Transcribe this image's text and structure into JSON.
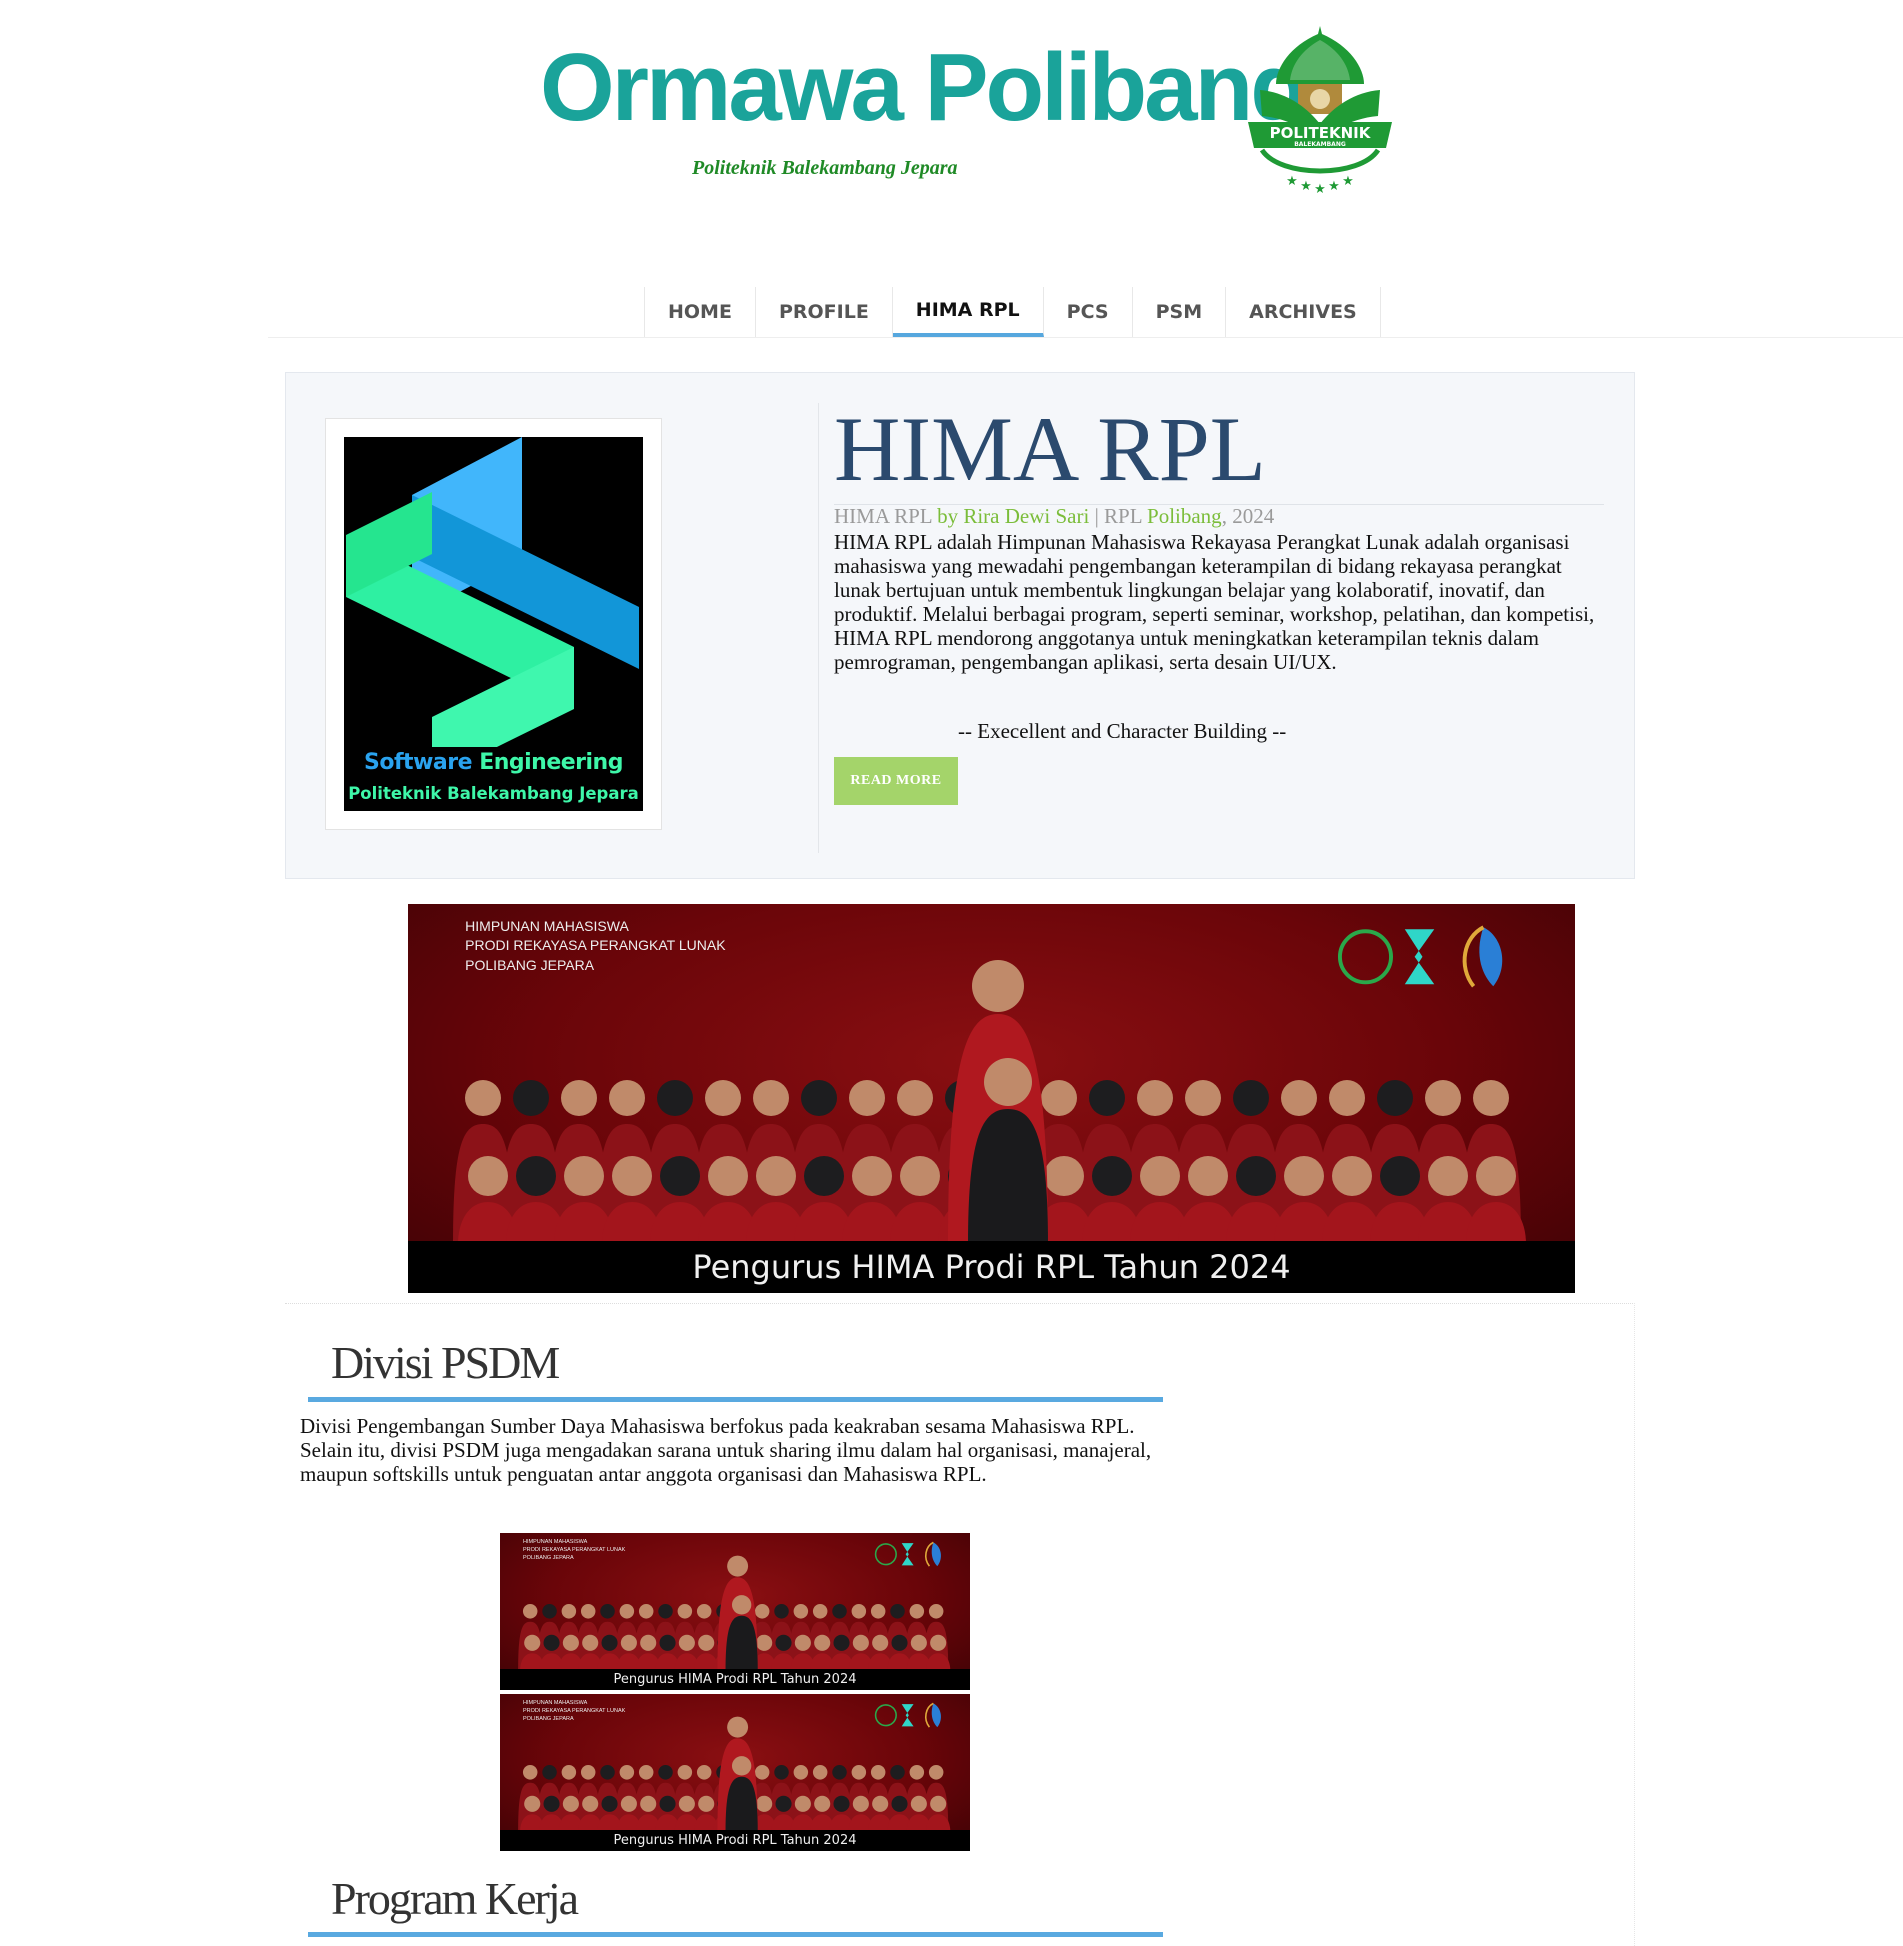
{
  "header": {
    "site_title": "Ormawa Polibang",
    "tagline": "Politeknik Balekambang Jepara",
    "logo_text": "POLITEKNIK",
    "logo_subtext": "BALEKAMBANG"
  },
  "nav": {
    "items": [
      "HOME",
      "PROFILE",
      "HIMA RPL",
      "PCS",
      "PSM",
      "ARCHIVES"
    ],
    "active": "HIMA RPL"
  },
  "feature": {
    "thumb_line1_a": "Software",
    "thumb_line1_b": "Engineering",
    "thumb_line2": "Politeknik Balekambang Jepara",
    "title": "HIMA RPL",
    "meta_category": "HIMA RPL",
    "meta_by": "by",
    "meta_author": "Rira Dewi Sari",
    "meta_sep": "|",
    "meta_tag1": "RPL",
    "meta_tag2": "Polibang",
    "meta_year": ", 2024",
    "body": "HIMA RPL adalah Himpunan Mahasiswa Rekayasa Perangkat Lunak adalah organisasi mahasiswa yang mewadahi pengembangan keterampilan di bidang rekayasa perangkat lunak bertujuan untuk membentuk lingkungan belajar yang kolaboratif, inovatif, dan produktif. Melalui berbagai program, seperti seminar, workshop, pelatihan, dan kompetisi, HIMA RPL mendorong anggotanya untuk meningkatkan keterampilan teknis dalam pemrograman, pengembangan aplikasi, serta desain UI/UX.",
    "quote": "-- Execellent and Character Building --",
    "read_more": "READ MORE"
  },
  "banner": {
    "org_line1": "HIMPUNAN MAHASISWA",
    "org_line2": "PRODI REKAYASA PERANGKAT LUNAK",
    "org_line3": "POLIBANG JEPARA",
    "caption": "Pengurus HIMA Prodi RPL Tahun 2024"
  },
  "sections": {
    "psdm_title": "Divisi PSDM",
    "psdm_body": "Divisi Pengembangan Sumber Daya Mahasiswa berfokus pada keakraban sesama Mahasiswa RPL. Selain itu, divisi PSDM juga mengadakan sarana untuk sharing ilmu dalam hal organisasi, manajeral, maupun softskills untuk penguatan antar anggota organisasi dan Mahasiswa RPL.",
    "proker_title": "Program Kerja"
  },
  "colors": {
    "title_teal": "#1aa39a",
    "tagline_green": "#1f8a26",
    "nav_active_underline": "#56a7de",
    "feature_title": "#2b4a6e",
    "meta_green": "#7bbd3a",
    "button_green": "#a4d46a",
    "section_rule": "#59a9e0",
    "banner_red": "#6a0509"
  }
}
